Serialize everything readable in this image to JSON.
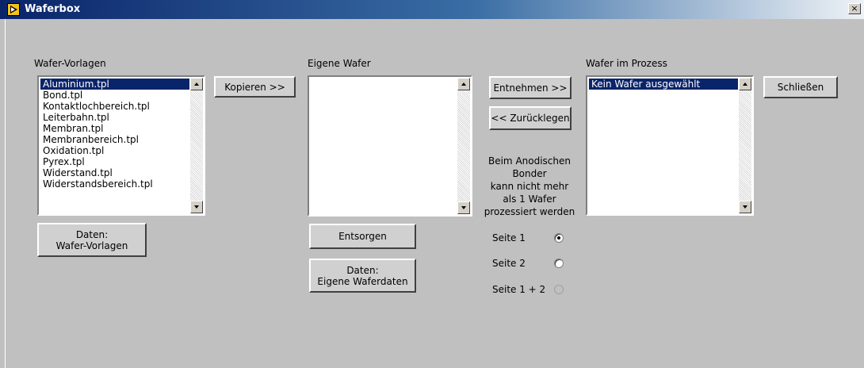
{
  "window": {
    "title": "Waferbox",
    "close_glyph": "×",
    "app_icon": "labview-run-icon"
  },
  "templates": {
    "label": "Wafer-Vorlagen",
    "items": [
      "Aluminium.tpl",
      "Bond.tpl",
      "Kontaktlochbereich.tpl",
      "Leiterbahn.tpl",
      "Membran.tpl",
      "Membranbereich.tpl",
      "Oxidation.tpl",
      "Pyrex.tpl",
      "Widerstand.tpl",
      "Widerstandsbereich.tpl"
    ],
    "selected_index": 0,
    "data_button": "Daten:\nWafer-Vorlagen"
  },
  "copy_button": "Kopieren >>",
  "own": {
    "label": "Eigene Wafer",
    "items": [],
    "dispose_button": "Entsorgen",
    "data_button": "Daten:\nEigene Waferdaten"
  },
  "take_button": "Entnehmen >>",
  "return_button": "<< Zurücklegen",
  "note": "Beim Anodischen\nBonder\nkann nicht mehr\nals 1 Wafer\nprozessiert werden",
  "sides": [
    {
      "label": "Seite 1",
      "checked": true,
      "enabled": true
    },
    {
      "label": "Seite 2",
      "checked": false,
      "enabled": true
    },
    {
      "label": "Seite 1 + 2",
      "checked": false,
      "enabled": false
    }
  ],
  "process": {
    "label": "Wafer im Prozess",
    "items": [
      "Kein Wafer ausgewählt"
    ],
    "selected_index": 0
  },
  "close_button": "Schließen"
}
